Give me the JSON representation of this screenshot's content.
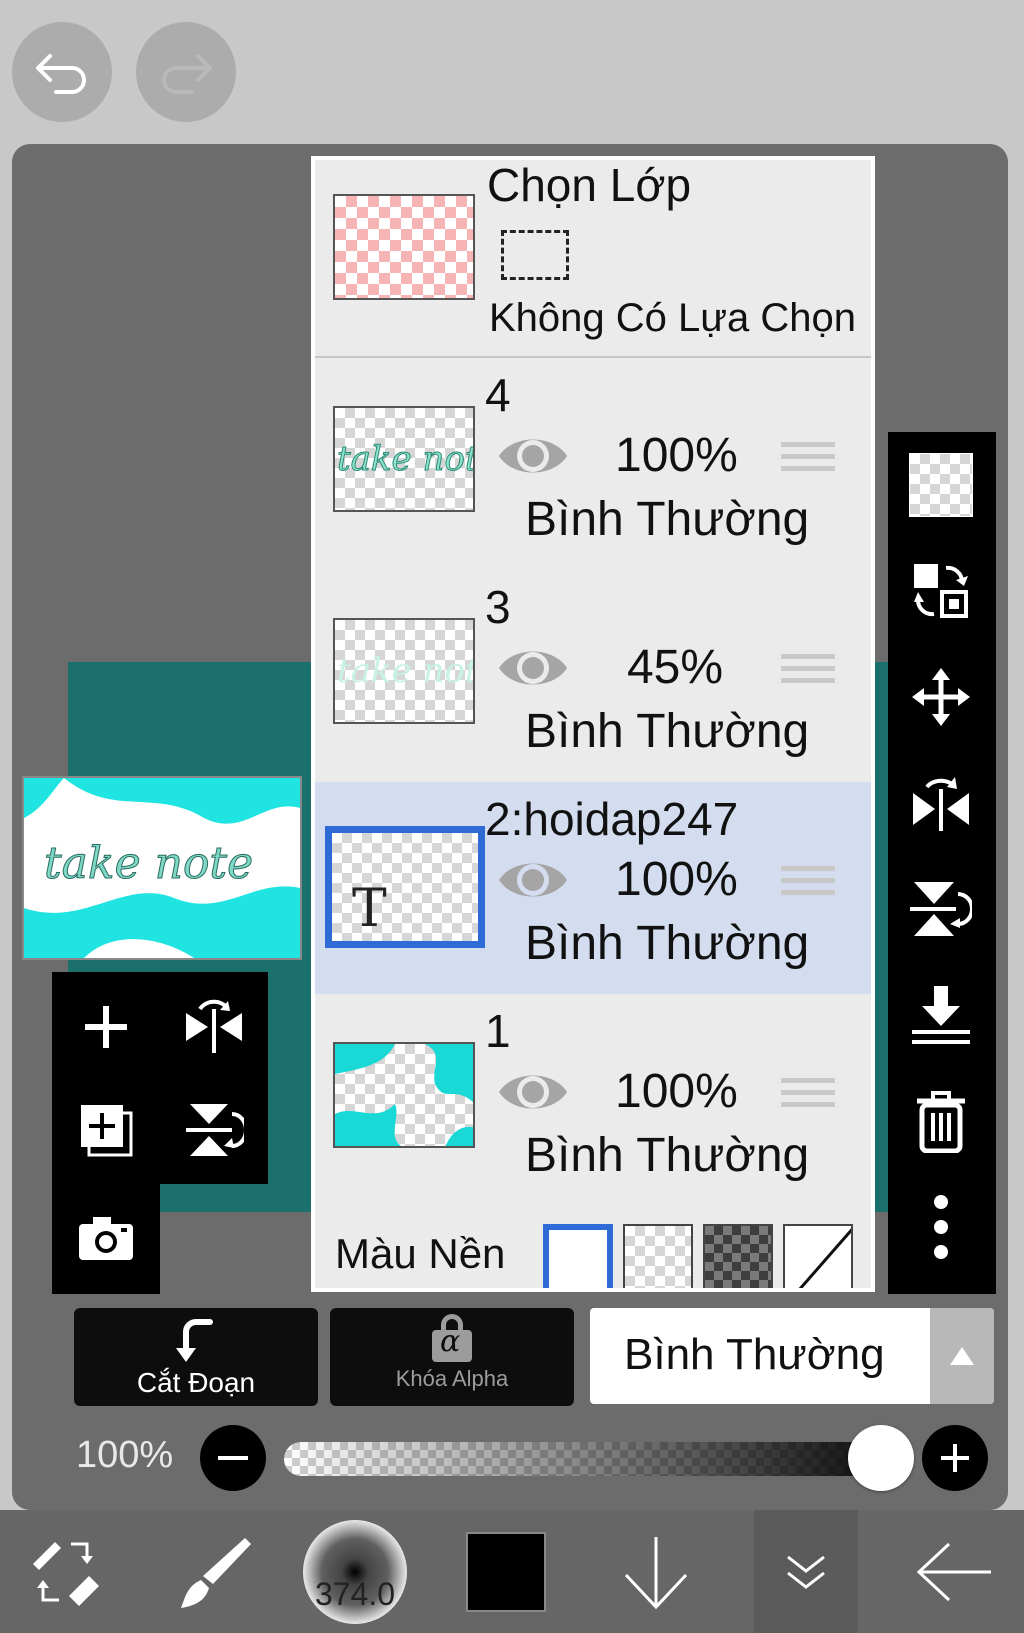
{
  "top_toolbar": {
    "undo_icon": "undo-arrow",
    "redo_icon": "redo-arrow"
  },
  "selection": {
    "title": "Chọn Lớp",
    "status": "Không Có Lựa Chọn"
  },
  "layers": [
    {
      "name": "4",
      "opacity": "100%",
      "mode": "Bình Thường",
      "selected": false
    },
    {
      "name": "3",
      "opacity": "45%",
      "mode": "Bình Thường",
      "selected": false
    },
    {
      "name": "2:hoidap247",
      "opacity": "100%",
      "mode": "Bình Thường",
      "selected": true,
      "type_glyph": "T"
    },
    {
      "name": "1",
      "opacity": "100%",
      "mode": "Bình Thường",
      "selected": false
    }
  ],
  "background": {
    "label": "Màu Nền"
  },
  "bottom_bar": {
    "clip_label": "Cắt Đoạn",
    "alpha_lock_label": "Khóa Alpha",
    "alpha_glyph": "α",
    "blend_mode": "Bình Thường",
    "opacity_value": "100%",
    "opacity_fraction": 1.0
  },
  "tools": {
    "brush_size": "374.0"
  },
  "colors": {
    "accent": "#2f6bd6",
    "selected_row": "#d3ddef",
    "teal": "#19d8d6",
    "panel_bg": "#ebebeb"
  }
}
